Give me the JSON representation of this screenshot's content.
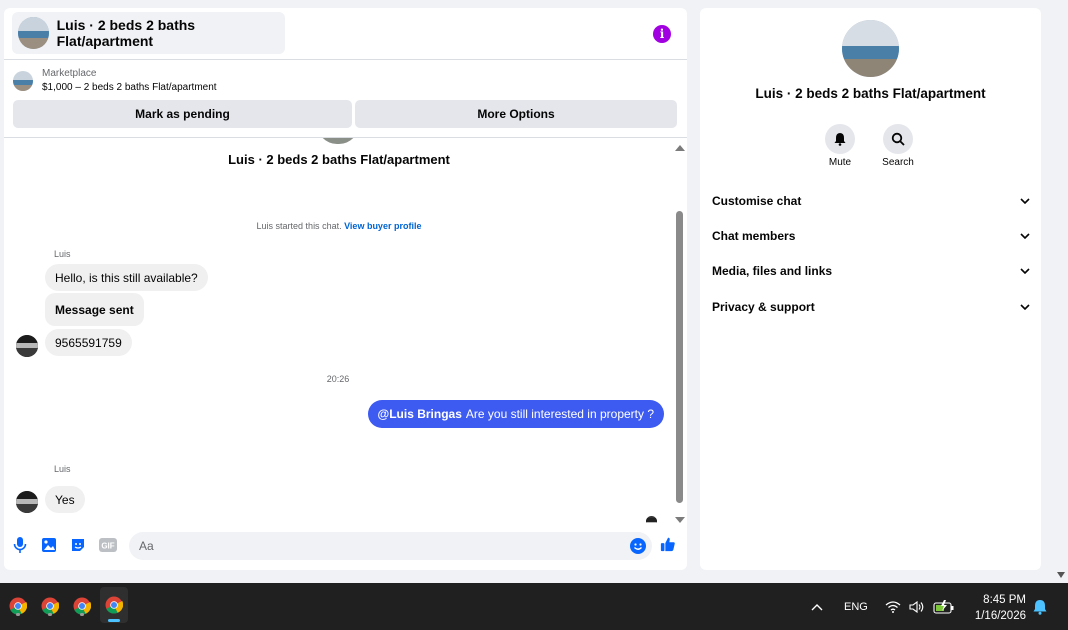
{
  "chat": {
    "header_title": "Luis · 2 beds 2 baths Flat/apartment",
    "info_icon": "info-icon",
    "listing": {
      "source": "Marketplace",
      "summary": "$1,000 – 2 beds 2 baths Flat/apartment"
    },
    "buttons": {
      "mark_pending": "Mark as pending",
      "more_options": "More Options"
    },
    "center_title": "Luis · 2 beds 2 baths Flat/apartment",
    "started_note": "Luis started this chat.",
    "view_profile_link": "View buyer profile",
    "messages": [
      {
        "sender": "Luis",
        "text": "Hello, is this still available?"
      },
      {
        "text": "Message sent"
      },
      {
        "text": "9565591759"
      }
    ],
    "time_separator": "20:26",
    "outgoing": {
      "mention": "@Luis Bringas",
      "text": "Are you still interested in property ?"
    },
    "second_group": {
      "sender": "Luis",
      "text": "Yes"
    },
    "composer": {
      "placeholder": "Aa",
      "icons": [
        "microphone-icon",
        "image-icon",
        "sticker-icon",
        "gif-icon",
        "emoji-icon",
        "thumbs-up-icon"
      ],
      "gif_label": "GIF"
    }
  },
  "info_panel": {
    "title": "Luis · 2 beds 2 baths Flat/apartment",
    "mute_label": "Mute",
    "search_label": "Search",
    "sections": [
      {
        "label": "Customise chat"
      },
      {
        "label": "Chat members"
      },
      {
        "label": "Media, files and links"
      },
      {
        "label": "Privacy & support"
      }
    ]
  },
  "taskbar": {
    "apps": [
      "chrome-icon",
      "chrome-icon",
      "chrome-icon",
      "chrome-icon"
    ],
    "language": "ENG",
    "time": "8:45 PM",
    "date": "1/16/2026"
  },
  "colors": {
    "accent": "#0866ff",
    "outgoing_bubble": "#3d5af1",
    "info_icon": "#a100e0",
    "taskbar_bg": "#202020"
  }
}
